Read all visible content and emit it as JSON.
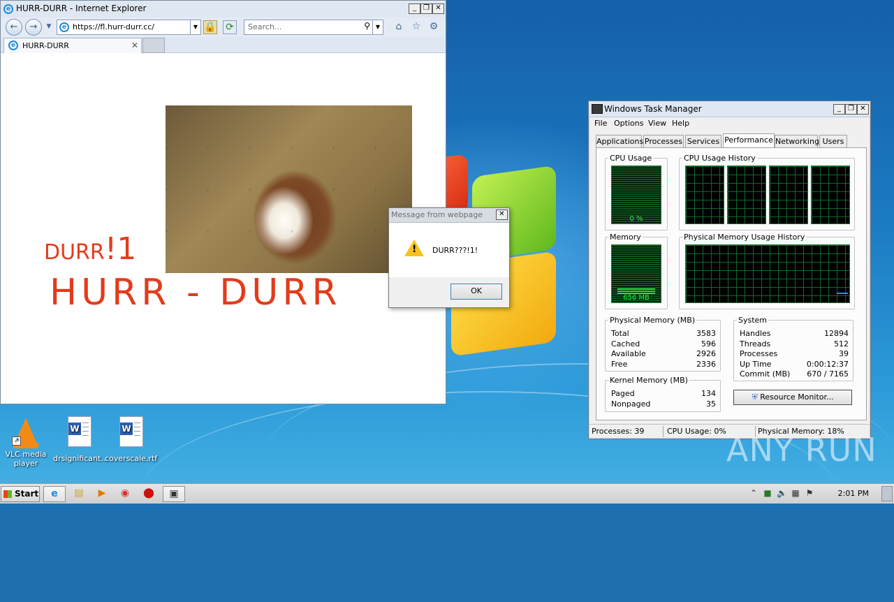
{
  "ie": {
    "window_title": "HURR-DURR - Internet Explorer",
    "address": "https://fl.hurr-durr.cc/",
    "search_placeholder": "Search...",
    "tab_label": "HURR-DURR",
    "page": {
      "small_text": "DURR",
      "small_text_big": "!1",
      "big_text": "HURR - DURR"
    }
  },
  "message_box": {
    "title": "Message from webpage",
    "message": "DURR???!1!",
    "ok_label": "OK"
  },
  "task_manager": {
    "title": "Windows Task Manager",
    "menu": [
      "File",
      "Options",
      "View",
      "Help"
    ],
    "tabs": [
      "Applications",
      "Processes",
      "Services",
      "Performance",
      "Networking",
      "Users"
    ],
    "active_tab": "Performance",
    "cpu_usage_label": "CPU Usage",
    "cpu_usage_value": "0 %",
    "cpu_history_label": "CPU Usage History",
    "memory_label": "Memory",
    "memory_value": "656 MB",
    "memory_history_label": "Physical Memory Usage History",
    "physical_memory": {
      "title": "Physical Memory (MB)",
      "rows": [
        {
          "k": "Total",
          "v": "3583"
        },
        {
          "k": "Cached",
          "v": "596"
        },
        {
          "k": "Available",
          "v": "2926"
        },
        {
          "k": "Free",
          "v": "2336"
        }
      ]
    },
    "system": {
      "title": "System",
      "rows": [
        {
          "k": "Handles",
          "v": "12894"
        },
        {
          "k": "Threads",
          "v": "512"
        },
        {
          "k": "Processes",
          "v": "39"
        },
        {
          "k": "Up Time",
          "v": "0:00:12:37"
        },
        {
          "k": "Commit (MB)",
          "v": "670 / 7165"
        }
      ]
    },
    "kernel_memory": {
      "title": "Kernel Memory (MB)",
      "rows": [
        {
          "k": "Paged",
          "v": "134"
        },
        {
          "k": "Nonpaged",
          "v": "35"
        }
      ]
    },
    "resource_monitor_label": "Resource Monitor...",
    "status": {
      "processes": "Processes: 39",
      "cpu": "CPU Usage: 0%",
      "memory": "Physical Memory: 18%"
    }
  },
  "desktop_icons": [
    {
      "label": "VLC media player"
    },
    {
      "label": "drsignificant..."
    },
    {
      "label": "coverscale.rtf"
    }
  ],
  "taskbar": {
    "start_label": "Start",
    "clock": "2:01 PM"
  },
  "watermark": "ANY RUN"
}
